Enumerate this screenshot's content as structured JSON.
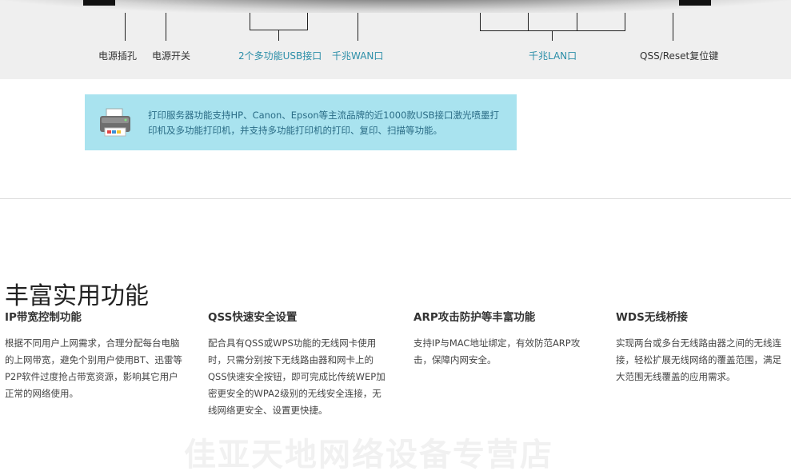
{
  "ports": {
    "power_jack": "电源插孔",
    "power_switch": "电源开关",
    "usb": "2个多功能USB接口",
    "wan": "千兆WAN口",
    "lan": "千兆LAN口",
    "qss_reset": "QSS/Reset复位键"
  },
  "info_box": {
    "icon": "printer-icon",
    "text": "打印服务器功能支持HP、Canon、Epson等主流品牌的近1000款USB接口激光喷墨打印机及多功能打印机，并支持多功能打印机的打印、复印、扫描等功能。"
  },
  "section": {
    "title": "丰富实用功能"
  },
  "features": [
    {
      "title": "IP带宽控制功能",
      "desc": "根据不同用户上网需求，合理分配每台电脑的上网带宽，避免个别用户使用BT、迅雷等P2P软件过度抢占带宽资源，影响其它用户正常的网络使用。"
    },
    {
      "title": "QSS快速安全设置",
      "desc": "配合具有QSS或WPS功能的无线网卡使用时，只需分别按下无线路由器和网卡上的QSS快速安全按钮，即可完成比传统WEP加密更安全的WPA2级别的无线安全连接，无线网络更安全、设置更快捷。"
    },
    {
      "title": "ARP攻击防护等丰富功能",
      "desc": "支持IP与MAC地址绑定，有效防范ARP攻击，保障内网安全。"
    },
    {
      "title": "WDS无线桥接",
      "desc": "实现两台或多台无线路由器之间的无线连接，轻松扩展无线网络的覆盖范围，满足大范围无线覆盖的应用需求。"
    }
  ],
  "watermark": "佳亚天地网络设备专营店",
  "colors": {
    "accent_teal": "#2b8ea8",
    "info_bg": "#a9e3ef",
    "band_bg": "#efefef"
  }
}
